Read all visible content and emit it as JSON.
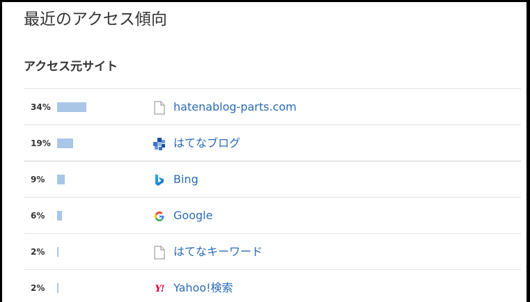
{
  "page": {
    "title": "最近のアクセス傾向"
  },
  "section": {
    "title": "アクセス元サイト"
  },
  "colors": {
    "bar": "#aac6e6",
    "link": "#2a6bb5",
    "text": "#333333"
  },
  "sources": [
    {
      "percent": "34%",
      "share": 34,
      "name": "hatenablog-parts.com",
      "icon": "document-icon"
    },
    {
      "percent": "19%",
      "share": 19,
      "name": "はてなブログ",
      "icon": "hatena-blog-icon"
    },
    {
      "percent": "9%",
      "share": 9,
      "name": "Bing",
      "icon": "bing-icon"
    },
    {
      "percent": "6%",
      "share": 6,
      "name": "Google",
      "icon": "google-icon"
    },
    {
      "percent": "2%",
      "share": 2,
      "name": "はてなキーワード",
      "icon": "document-icon"
    },
    {
      "percent": "2%",
      "share": 2,
      "name": "Yahoo!検索",
      "icon": "yahoo-icon"
    }
  ]
}
